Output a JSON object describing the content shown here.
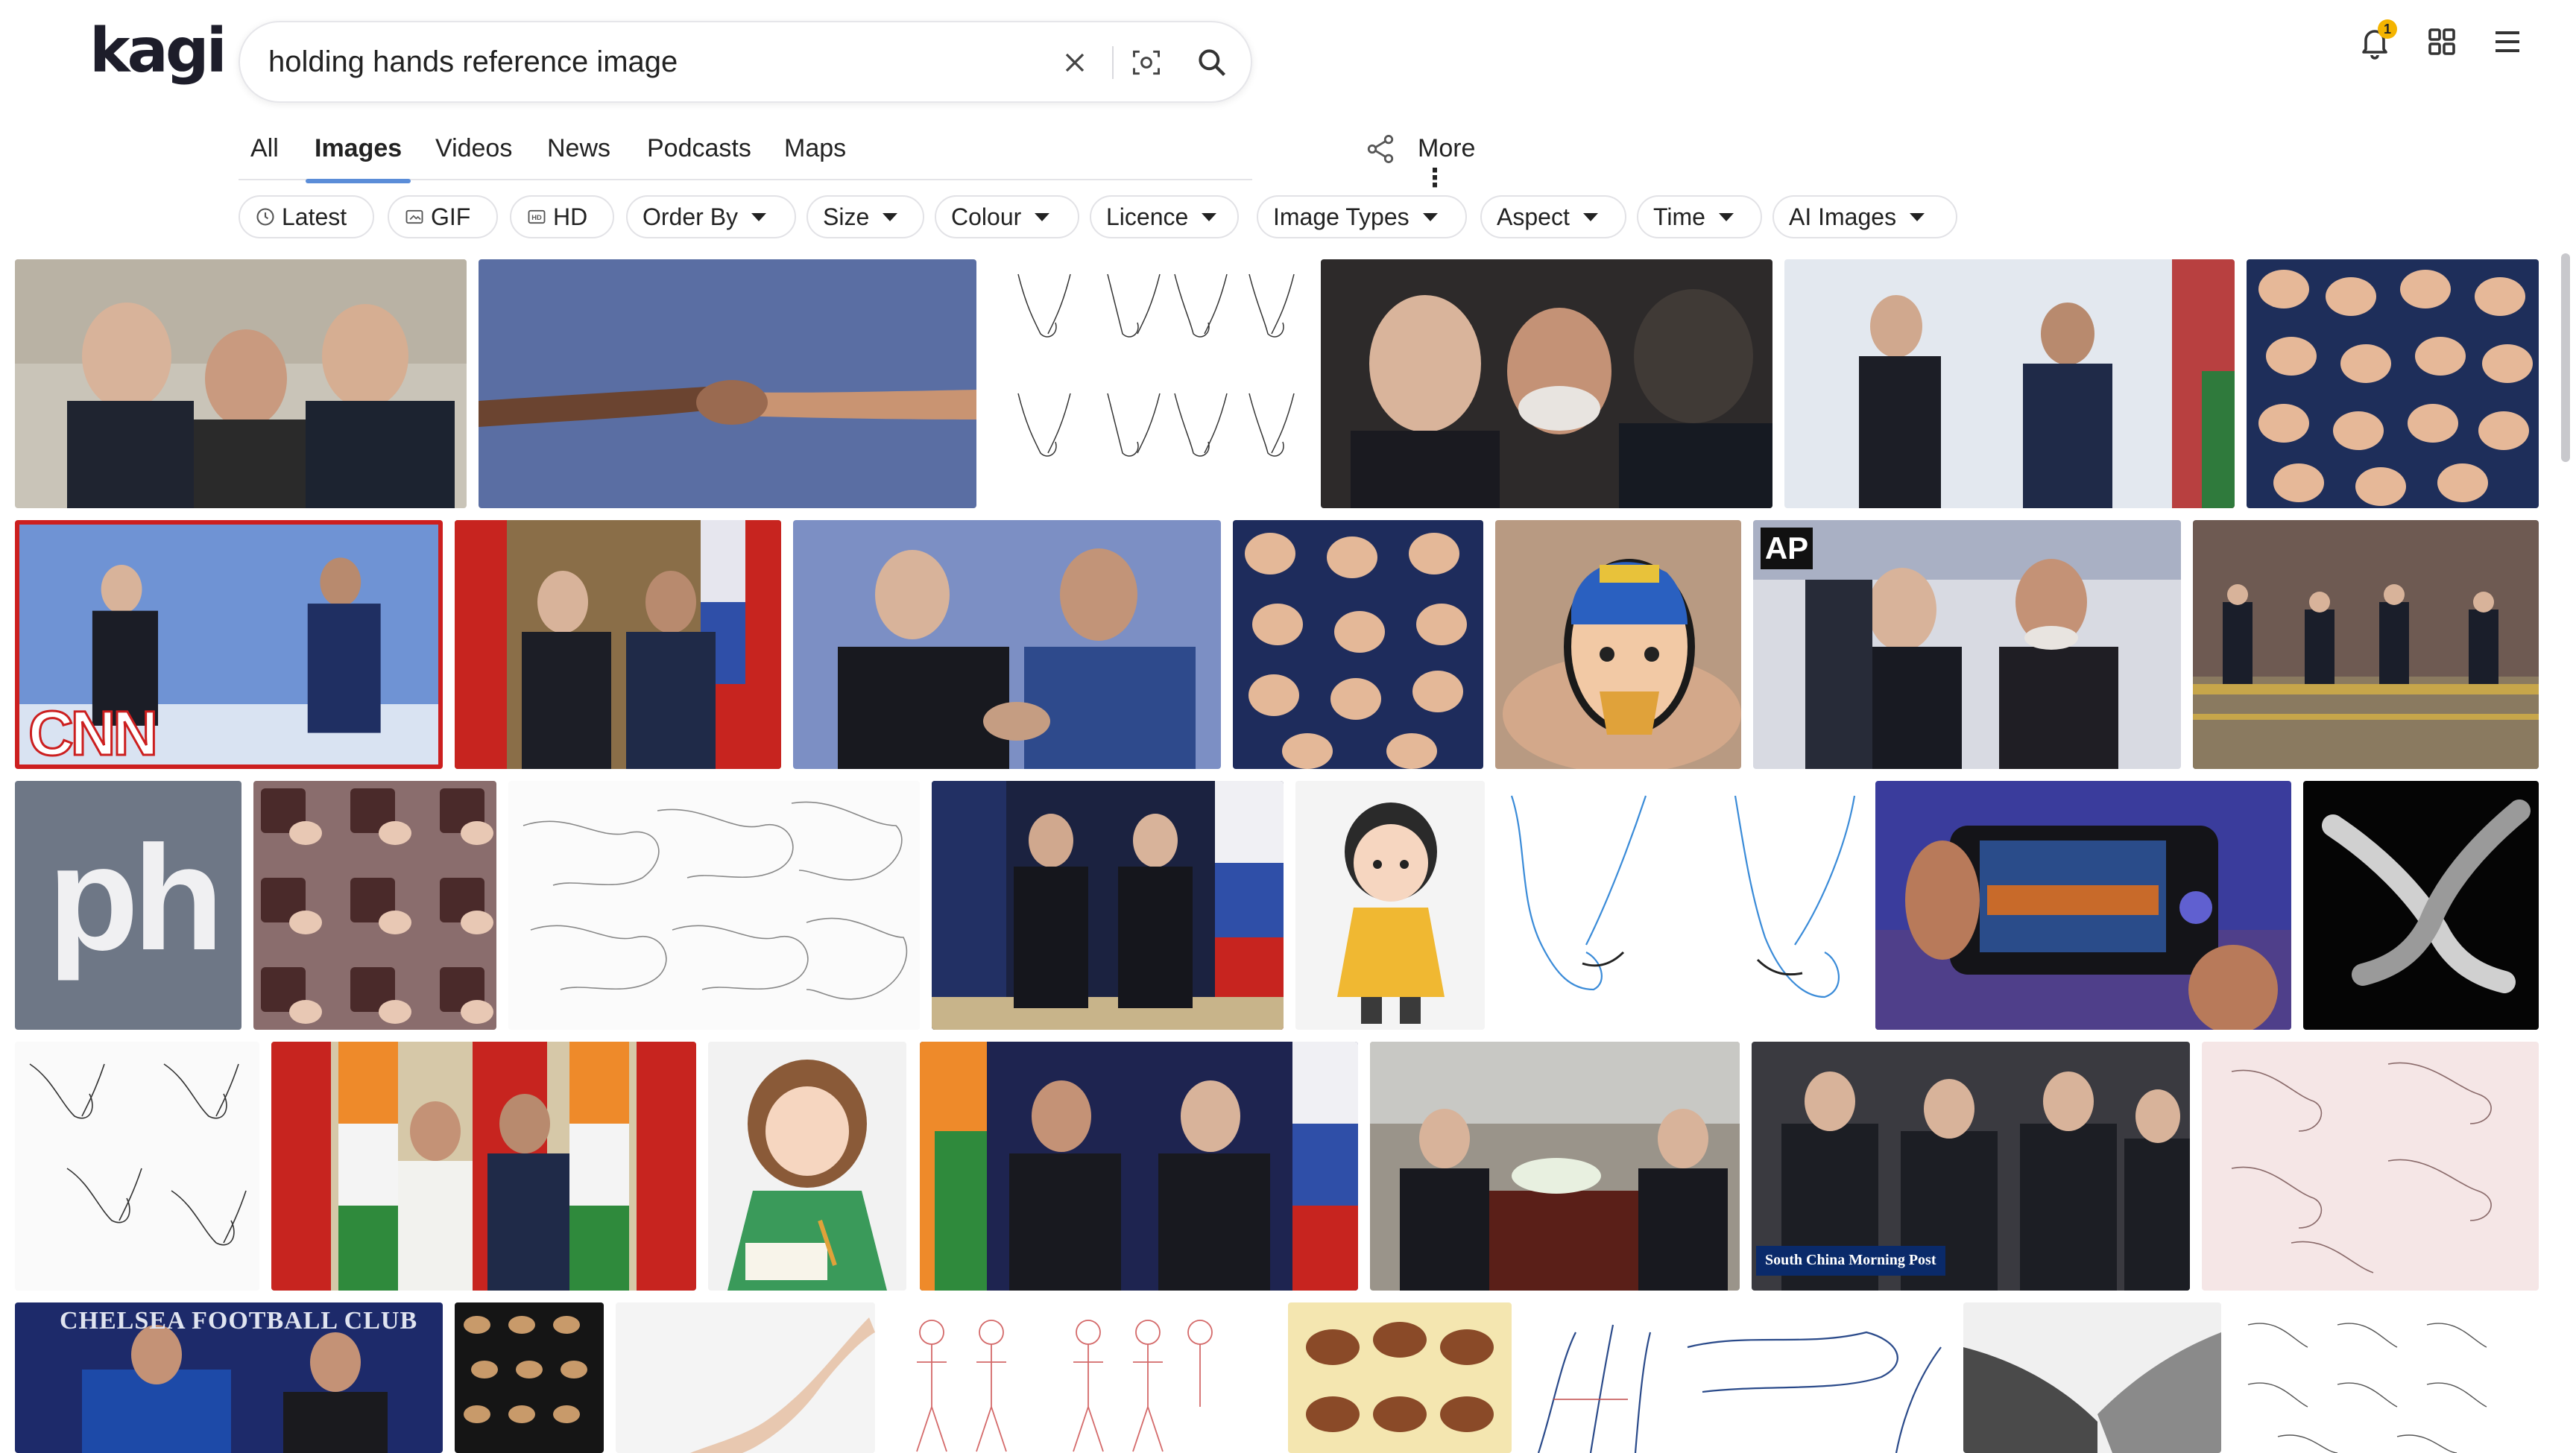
{
  "brand": {
    "logo_text": "kagi"
  },
  "search": {
    "query": "holding hands reference image",
    "clear_icon": "close-icon",
    "image_search_icon": "image-search-icon",
    "submit_icon": "search-icon"
  },
  "header": {
    "notifications_icon": "bell-icon",
    "notifications_count": "1",
    "apps_icon": "grid-icon",
    "menu_icon": "hamburger-menu-icon"
  },
  "tabs": [
    {
      "label": "All",
      "active": false
    },
    {
      "label": "Images",
      "active": true
    },
    {
      "label": "Videos",
      "active": false
    },
    {
      "label": "News",
      "active": false
    },
    {
      "label": "Podcasts",
      "active": false
    },
    {
      "label": "Maps",
      "active": false
    }
  ],
  "more_label": "More",
  "filters": [
    {
      "label": "Latest",
      "icon": "clock-icon",
      "dropdown": false
    },
    {
      "label": "GIF",
      "icon": "gif-icon",
      "dropdown": false
    },
    {
      "label": "HD",
      "icon": "hd-icon",
      "dropdown": false
    },
    {
      "label": "Order By",
      "dropdown": true
    },
    {
      "label": "Size",
      "dropdown": true
    },
    {
      "label": "Colour",
      "dropdown": true
    },
    {
      "label": "Licence",
      "dropdown": true
    },
    {
      "label": "Image Types",
      "dropdown": true
    },
    {
      "label": "Aspect",
      "dropdown": true
    },
    {
      "label": "Time",
      "dropdown": true
    },
    {
      "label": "AI Images",
      "dropdown": true
    }
  ],
  "results": {
    "watermarks": {
      "cnn": "CNN",
      "ap": "AP",
      "ph": "ph",
      "scmp": "South China Morning Post",
      "chelsea": "CHELSEA FOOTBALL CLUB"
    }
  },
  "colors": {
    "tab_underline": "#5b8dd8",
    "notification_badge": "#f4b400"
  }
}
